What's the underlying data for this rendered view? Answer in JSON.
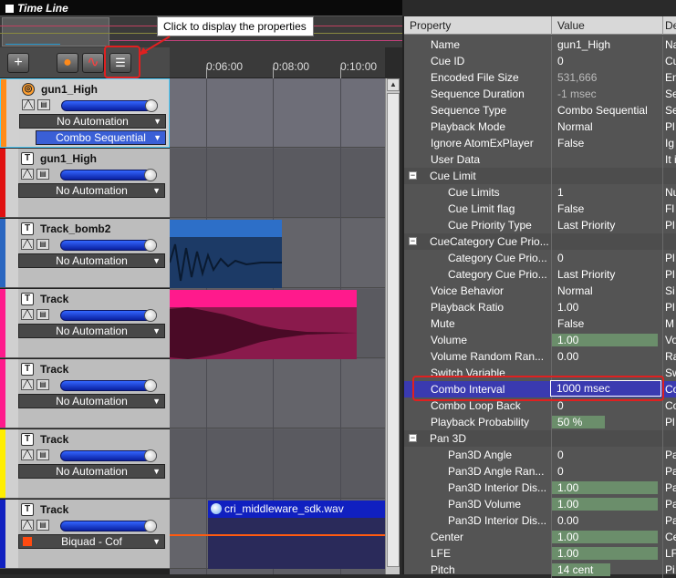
{
  "window": {
    "title": "Time Line"
  },
  "tooltip": "Click to display the properties",
  "toolbar": {
    "add": "+",
    "sphere": "●",
    "curve": "∿",
    "props": "☰"
  },
  "ruler": {
    "ticks": [
      "0:06:00",
      "0:08:00",
      "0:10:00"
    ]
  },
  "tracks": [
    {
      "name": "gun1_High",
      "color": "#ff8c1a",
      "automation": "No Automation",
      "combo": "Combo Sequential",
      "selected": true
    },
    {
      "name": "gun1_High",
      "color": "#e01010",
      "automation": "No Automation"
    },
    {
      "name": "Track_bomb2",
      "color": "#2a66c0",
      "automation": "No Automation"
    },
    {
      "name": "Track",
      "color": "#ff1a8c",
      "automation": "No Automation"
    },
    {
      "name": "Track",
      "color": "#ff1a8c",
      "automation": "No Automation"
    },
    {
      "name": "Track",
      "color": "#ffee00",
      "automation": "No Automation"
    },
    {
      "name": "Track",
      "color": "#1020c0",
      "automation": "Biquad - Cof"
    }
  ],
  "clips": {
    "wav_name": "cri_middleware_sdk.wav"
  },
  "properties": {
    "headers": {
      "property": "Property",
      "value": "Value",
      "desc": "De"
    },
    "rows": [
      {
        "name": "Name",
        "value": "gun1_High",
        "desc": "Na",
        "indent": 1
      },
      {
        "name": "Cue ID",
        "value": "0",
        "desc": "Cu",
        "indent": 1
      },
      {
        "name": "Encoded File Size",
        "value": "531,666",
        "desc": "En",
        "indent": 1
      },
      {
        "name": "Sequence Duration",
        "value": "-1 msec",
        "desc": "Se",
        "indent": 1
      },
      {
        "name": "Sequence Type",
        "value": "Combo Sequential",
        "desc": "Se",
        "indent": 1
      },
      {
        "name": "Playback Mode",
        "value": "Normal",
        "desc": "Pl",
        "indent": 1
      },
      {
        "name": "Ignore AtomExPlayer",
        "value": "False",
        "desc": "Ig",
        "indent": 1
      },
      {
        "name": "User Data",
        "value": "",
        "desc": "It i",
        "indent": 1
      },
      {
        "name": "Cue Limit",
        "value": "",
        "desc": "",
        "group": true
      },
      {
        "name": "Cue Limits",
        "value": "1",
        "desc": "Nu",
        "indent": 2
      },
      {
        "name": "Cue Limit flag",
        "value": "False",
        "desc": "Fl",
        "indent": 2
      },
      {
        "name": "Cue Priority Type",
        "value": "Last Priority",
        "desc": "Pl",
        "indent": 2
      },
      {
        "name": "CueCategory Cue Prio...",
        "value": "",
        "desc": "",
        "group": true
      },
      {
        "name": "Category Cue Prio...",
        "value": "0",
        "desc": "Pl",
        "indent": 2
      },
      {
        "name": "Category Cue Prio...",
        "value": "Last Priority",
        "desc": "Pl",
        "indent": 2
      },
      {
        "name": "Voice Behavior",
        "value": "Normal",
        "desc": "Si",
        "indent": 1
      },
      {
        "name": "Playback Ratio",
        "value": "1.00",
        "desc": "Pl",
        "indent": 1
      },
      {
        "name": "Mute",
        "value": "False",
        "desc": "M",
        "indent": 1
      },
      {
        "name": "Volume",
        "value": "1.00",
        "desc": "Vo",
        "indent": 1,
        "bar": 1.0
      },
      {
        "name": "Volume Random Ran...",
        "value": "0.00",
        "desc": "Ra",
        "indent": 1
      },
      {
        "name": "Switch Variable",
        "value": "",
        "desc": "Sw",
        "indent": 1
      },
      {
        "name": "Combo Interval",
        "value": "1000 msec",
        "desc": "Co",
        "indent": 1,
        "selected": true
      },
      {
        "name": "Combo Loop Back",
        "value": "0",
        "desc": "Co",
        "indent": 1
      },
      {
        "name": "Playback Probability",
        "value": "50 %",
        "desc": "Pl",
        "indent": 1,
        "bar": 0.5
      },
      {
        "name": "Pan 3D",
        "value": "",
        "desc": "",
        "group": true
      },
      {
        "name": "Pan3D Angle",
        "value": "0",
        "desc": "Pa",
        "indent": 2
      },
      {
        "name": "Pan3D Angle Ran...",
        "value": "0",
        "desc": "Pa",
        "indent": 2
      },
      {
        "name": "Pan3D Interior Dis...",
        "value": "1.00",
        "desc": "Pa",
        "indent": 2,
        "bar": 1.0
      },
      {
        "name": "Pan3D Volume",
        "value": "1.00",
        "desc": "Pa",
        "indent": 2,
        "bar": 1.0
      },
      {
        "name": "Pan3D Interior Dis...",
        "value": "0.00",
        "desc": "Pa",
        "indent": 2
      },
      {
        "name": "Center",
        "value": "1.00",
        "desc": "Ce",
        "indent": 1,
        "bar": 1.0
      },
      {
        "name": "LFE",
        "value": "1.00",
        "desc": "LF",
        "indent": 1,
        "bar": 1.0
      },
      {
        "name": "Pitch",
        "value": "14 cent",
        "desc": "Pi",
        "indent": 1,
        "bar": 0.55
      }
    ]
  }
}
